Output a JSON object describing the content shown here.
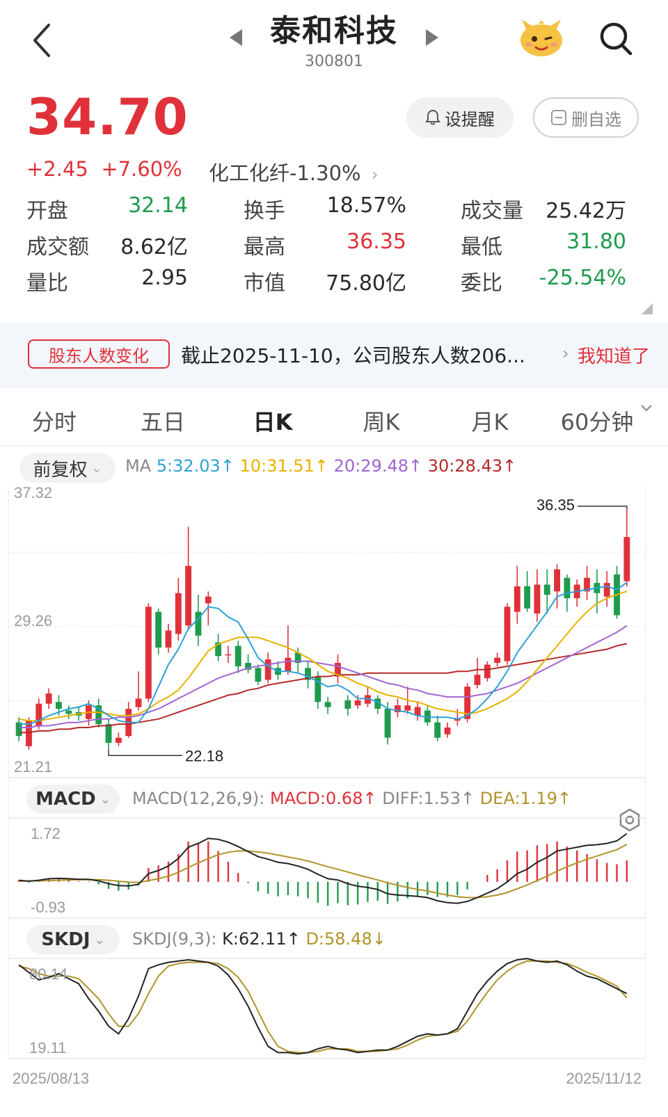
{
  "header": {
    "title": "泰和科技",
    "code": "300801"
  },
  "quote": {
    "price": "34.70",
    "change": "+2.45",
    "change_pct": "+7.60%",
    "sector": "化工化纤-1.30%",
    "remind_label": "设提醒",
    "unwatch_label": "删自选",
    "stats": [
      {
        "label": "开盘",
        "value": "32.14",
        "color": "green"
      },
      {
        "label": "换手",
        "value": "18.57%",
        "color": "dark"
      },
      {
        "label": "成交量",
        "value": "25.42万",
        "color": "dark"
      },
      {
        "label": "成交额",
        "value": "8.62亿",
        "color": "dark"
      },
      {
        "label": "最高",
        "value": "36.35",
        "color": "red"
      },
      {
        "label": "最低",
        "value": "31.80",
        "color": "green"
      },
      {
        "label": "量比",
        "value": "2.95",
        "color": "dark"
      },
      {
        "label": "市值",
        "value": "75.80亿",
        "color": "dark"
      },
      {
        "label": "委比",
        "value": "-25.54%",
        "color": "green"
      }
    ]
  },
  "notice": {
    "tag": "股东人数变化",
    "text": "截止2025-11-10，公司股东人数206...",
    "action": "我知道了"
  },
  "tabs": [
    "分时",
    "五日",
    "日K",
    "周K",
    "月K",
    "60分钟"
  ],
  "kline": {
    "adjust_label": "前复权",
    "ma_label": "MA",
    "ma5": "5:32.03↑",
    "ma10": "10:31.51↑",
    "ma20": "20:29.48↑",
    "ma30": "30:28.43↑",
    "y_top": "37.32",
    "y_mid": "29.26",
    "y_bottom": "21.21",
    "high_mark": "36.35",
    "low_mark": "22.18"
  },
  "macd": {
    "label": "MACD",
    "params": "MACD(12,26,9):",
    "macd": "MACD:0.68↑",
    "diff": "DIFF:1.53↑",
    "dea": "DEA:1.19↑",
    "y_top": "1.72",
    "y_bottom": "-0.93"
  },
  "skdj": {
    "label": "SKDJ",
    "params": "SKDJ(9,3):",
    "k": "K:62.11↑",
    "d": "D:58.48↓",
    "y_top": "80.14",
    "y_bottom": "19.11"
  },
  "dates": {
    "start": "2025/08/13",
    "end": "2025/11/12"
  },
  "colors": {
    "up": "#e0313a",
    "down": "#1e9b4d",
    "ma5": "#2ba1d6",
    "ma10": "#e7b200",
    "ma20": "#a066d3",
    "ma30": "#b42a2a"
  },
  "chart_data": {
    "type": "candlestick",
    "ohlc": [
      [
        23.8,
        23.0,
        24.1,
        22.7
      ],
      [
        22.4,
        23.9,
        24.1,
        22.2
      ],
      [
        23.6,
        24.9,
        25.2,
        23.4
      ],
      [
        24.9,
        25.5,
        25.8,
        24.6
      ],
      [
        25.0,
        24.6,
        25.4,
        24.2
      ],
      [
        24.5,
        24.3,
        24.8,
        24.0
      ],
      [
        24.4,
        24.2,
        24.7,
        23.9
      ],
      [
        24.0,
        24.8,
        25.1,
        23.6
      ],
      [
        24.8,
        23.7,
        25.2,
        23.5
      ],
      [
        23.7,
        22.6,
        24.0,
        22.18
      ],
      [
        22.6,
        22.9,
        23.2,
        22.4
      ],
      [
        23.0,
        24.6,
        25.0,
        22.9
      ],
      [
        24.7,
        25.2,
        26.8,
        24.5
      ],
      [
        25.2,
        30.6,
        30.8,
        25.0
      ],
      [
        30.3,
        28.2,
        30.5,
        27.8
      ],
      [
        28.2,
        29.2,
        29.6,
        27.9
      ],
      [
        29.0,
        31.4,
        32.3,
        28.6
      ],
      [
        29.5,
        33.0,
        35.3,
        29.2
      ],
      [
        30.3,
        28.9,
        31.3,
        28.3
      ],
      [
        30.8,
        31.2,
        31.5,
        29.5
      ],
      [
        28.5,
        27.7,
        29.0,
        27.4
      ],
      [
        27.8,
        27.8,
        28.3,
        27.3
      ],
      [
        28.3,
        27.1,
        28.6,
        26.7
      ],
      [
        27.3,
        26.9,
        27.8,
        26.7
      ],
      [
        27.0,
        26.2,
        27.2,
        26.0
      ],
      [
        26.3,
        27.5,
        27.9,
        26.1
      ],
      [
        27.0,
        26.6,
        27.4,
        26.3
      ],
      [
        26.8,
        27.6,
        29.5,
        26.6
      ],
      [
        27.9,
        27.3,
        28.2,
        26.7
      ],
      [
        27.0,
        26.3,
        27.4,
        25.8
      ],
      [
        26.5,
        25.0,
        26.8,
        24.6
      ],
      [
        25.0,
        24.7,
        25.3,
        24.3
      ],
      [
        26.5,
        27.3,
        27.8,
        26.1
      ],
      [
        25.1,
        24.6,
        25.4,
        24.2
      ],
      [
        24.8,
        25.1,
        25.4,
        24.6
      ],
      [
        24.9,
        25.4,
        25.9,
        24.7
      ],
      [
        25.2,
        24.6,
        25.4,
        24.3
      ],
      [
        24.6,
        22.9,
        25.0,
        22.5
      ],
      [
        24.4,
        24.8,
        25.2,
        24.1
      ],
      [
        24.5,
        24.8,
        25.9,
        24.3
      ],
      [
        24.2,
        24.7,
        25.0,
        23.9
      ],
      [
        24.5,
        23.8,
        24.8,
        23.6
      ],
      [
        23.8,
        22.9,
        24.2,
        22.7
      ],
      [
        23.1,
        23.5,
        23.8,
        22.9
      ],
      [
        23.9,
        24.0,
        24.6,
        23.6
      ],
      [
        24.0,
        25.9,
        26.1,
        23.8
      ],
      [
        26.0,
        26.6,
        27.6,
        25.8
      ],
      [
        26.4,
        27.2,
        27.4,
        26.2
      ],
      [
        27.3,
        27.6,
        27.9,
        27.1
      ],
      [
        27.4,
        30.6,
        30.8,
        27.2
      ],
      [
        30.3,
        31.8,
        33.0,
        29.6
      ],
      [
        31.8,
        30.5,
        32.7,
        30.3
      ],
      [
        30.2,
        31.9,
        32.8,
        29.7
      ],
      [
        31.9,
        31.3,
        32.8,
        30.2
      ],
      [
        31.5,
        32.8,
        33.1,
        30.5
      ],
      [
        32.3,
        31.1,
        32.5,
        30.3
      ],
      [
        31.1,
        31.9,
        32.2,
        30.6
      ],
      [
        31.5,
        32.3,
        33.0,
        31.0
      ],
      [
        32.0,
        31.4,
        32.8,
        30.2
      ],
      [
        31.2,
        32.0,
        32.7,
        30.6
      ],
      [
        32.5,
        30.1,
        33.0,
        29.9
      ],
      [
        32.1,
        34.7,
        36.35,
        31.8
      ]
    ],
    "ma5": [
      23.7,
      23.7,
      23.9,
      24.2,
      24.4,
      24.6,
      24.7,
      24.9,
      24.6,
      24.2,
      23.9,
      23.8,
      23.8,
      24.6,
      25.9,
      27.2,
      28.1,
      29.3,
      29.9,
      30.6,
      30.5,
      30.0,
      29.7,
      28.7,
      27.6,
      27.1,
      26.8,
      26.8,
      26.7,
      26.5,
      26.2,
      25.9,
      26.0,
      25.7,
      25.2,
      25.2,
      25.0,
      24.6,
      24.5,
      24.4,
      24.2,
      24.1,
      24.1,
      24.1,
      24.0,
      24.2,
      24.6,
      25.2,
      25.9,
      26.8,
      27.9,
      28.7,
      29.5,
      30.3,
      31.2,
      31.4,
      31.5,
      31.6,
      31.7,
      31.8,
      31.6,
      32.03
    ],
    "ma10": [
      24.0,
      23.9,
      23.9,
      24.0,
      24.1,
      24.2,
      24.3,
      24.4,
      24.4,
      24.3,
      24.2,
      24.2,
      24.3,
      24.6,
      25.0,
      25.3,
      25.7,
      26.4,
      27.2,
      28.0,
      28.4,
      28.6,
      28.8,
      28.8,
      28.8,
      28.6,
      28.4,
      28.2,
      27.9,
      27.6,
      27.2,
      26.8,
      26.6,
      26.4,
      26.1,
      25.9,
      25.6,
      25.4,
      25.3,
      25.1,
      25.0,
      24.8,
      24.6,
      24.5,
      24.4,
      24.3,
      24.4,
      24.6,
      24.9,
      25.2,
      25.6,
      26.2,
      26.9,
      27.6,
      28.3,
      29.0,
      29.7,
      30.3,
      30.8,
      31.1,
      31.3,
      31.51
    ],
    "ma20": [
      23.5,
      23.5,
      23.6,
      23.6,
      23.7,
      23.8,
      23.8,
      23.9,
      24.0,
      24.0,
      24.1,
      24.1,
      24.2,
      24.4,
      24.6,
      24.9,
      25.2,
      25.5,
      25.8,
      26.1,
      26.4,
      26.6,
      26.8,
      27.0,
      27.1,
      27.2,
      27.3,
      27.4,
      27.4,
      27.4,
      27.3,
      27.2,
      27.1,
      26.9,
      26.7,
      26.5,
      26.3,
      26.1,
      26.0,
      25.8,
      25.7,
      25.5,
      25.4,
      25.3,
      25.3,
      25.3,
      25.4,
      25.5,
      25.7,
      25.9,
      26.1,
      26.4,
      26.7,
      27.0,
      27.3,
      27.6,
      27.9,
      28.2,
      28.5,
      28.8,
      29.1,
      29.48
    ],
    "ma30": [
      23.2,
      23.2,
      23.3,
      23.3,
      23.4,
      23.4,
      23.5,
      23.5,
      23.6,
      23.6,
      23.7,
      23.7,
      23.8,
      23.9,
      24.0,
      24.2,
      24.4,
      24.6,
      24.8,
      25.0,
      25.2,
      25.4,
      25.5,
      25.7,
      25.8,
      26.0,
      26.1,
      26.2,
      26.3,
      26.4,
      26.5,
      26.5,
      26.6,
      26.6,
      26.6,
      26.7,
      26.7,
      26.7,
      26.7,
      26.7,
      26.7,
      26.7,
      26.7,
      26.7,
      26.8,
      26.8,
      26.9,
      26.9,
      27.0,
      27.1,
      27.2,
      27.3,
      27.4,
      27.5,
      27.6,
      27.7,
      27.8,
      27.9,
      28.0,
      28.1,
      28.3,
      28.43
    ],
    "macd_diff": [
      0.05,
      0.02,
      0.05,
      0.1,
      0.11,
      0.1,
      0.08,
      0.08,
      0.03,
      -0.06,
      -0.12,
      -0.13,
      -0.08,
      0.26,
      0.36,
      0.5,
      0.74,
      1.1,
      1.22,
      1.38,
      1.35,
      1.26,
      1.12,
      0.96,
      0.8,
      0.72,
      0.62,
      0.58,
      0.5,
      0.4,
      0.24,
      0.1,
      0.06,
      -0.06,
      -0.14,
      -0.18,
      -0.24,
      -0.38,
      -0.42,
      -0.44,
      -0.46,
      -0.5,
      -0.6,
      -0.66,
      -0.68,
      -0.62,
      -0.5,
      -0.36,
      -0.22,
      0.0,
      0.26,
      0.4,
      0.62,
      0.78,
      0.98,
      1.04,
      1.1,
      1.16,
      1.18,
      1.22,
      1.3,
      1.53
    ],
    "macd_dea": [
      0.02,
      0.03,
      0.03,
      0.04,
      0.05,
      0.06,
      0.07,
      0.07,
      0.07,
      0.05,
      0.02,
      -0.01,
      -0.02,
      0.04,
      0.1,
      0.18,
      0.3,
      0.46,
      0.6,
      0.74,
      0.86,
      0.94,
      0.98,
      0.98,
      0.95,
      0.91,
      0.85,
      0.79,
      0.73,
      0.66,
      0.57,
      0.48,
      0.4,
      0.31,
      0.22,
      0.14,
      0.06,
      -0.03,
      -0.11,
      -0.18,
      -0.24,
      -0.29,
      -0.36,
      -0.42,
      -0.47,
      -0.5,
      -0.5,
      -0.47,
      -0.42,
      -0.34,
      -0.22,
      -0.1,
      0.04,
      0.18,
      0.34,
      0.48,
      0.6,
      0.72,
      0.82,
      0.92,
      1.02,
      1.19
    ],
    "skdj_k": [
      85,
      79,
      73,
      75,
      78,
      74,
      70,
      58,
      48,
      36,
      30,
      42,
      60,
      82,
      85,
      87,
      88,
      89,
      88,
      87,
      84,
      77,
      66,
      52,
      35,
      20,
      15,
      15,
      14,
      15,
      18,
      20,
      18,
      17,
      15,
      16,
      17,
      17,
      20,
      24,
      28,
      30,
      29,
      30,
      34,
      48,
      62,
      72,
      80,
      86,
      89,
      90,
      88,
      87,
      88,
      85,
      80,
      76,
      74,
      70,
      66,
      62.11
    ],
    "skdj_d": [
      84,
      82,
      78,
      76,
      76,
      76,
      74,
      66,
      58,
      46,
      36,
      36,
      46,
      62,
      76,
      84,
      86,
      87,
      87,
      87,
      86,
      82,
      75,
      64,
      48,
      32,
      20,
      16,
      15,
      15,
      16,
      18,
      18,
      18,
      16,
      16,
      16,
      17,
      18,
      21,
      25,
      28,
      29,
      30,
      32,
      40,
      52,
      63,
      73,
      80,
      85,
      88,
      88,
      88,
      87,
      86,
      83,
      79,
      76,
      72,
      68,
      58.48
    ]
  }
}
